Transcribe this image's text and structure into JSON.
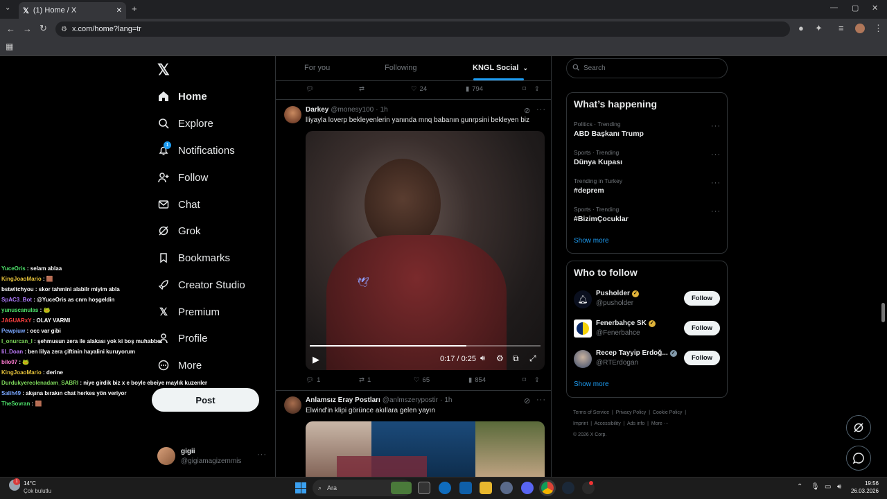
{
  "browser": {
    "tab_title": "(1) Home / X",
    "url": "x.com/home?lang=tr",
    "new_tab": "+",
    "controls": {
      "minimize": "—",
      "maximize": "▢",
      "close": "✕"
    }
  },
  "sidebar": {
    "items": [
      {
        "label": "Home",
        "icon": "home-icon"
      },
      {
        "label": "Explore",
        "icon": "search-icon"
      },
      {
        "label": "Notifications",
        "icon": "bell-icon",
        "badge": "1"
      },
      {
        "label": "Follow",
        "icon": "person-add-icon"
      },
      {
        "label": "Chat",
        "icon": "mail-icon"
      },
      {
        "label": "Grok",
        "icon": "grok-icon"
      },
      {
        "label": "Bookmarks",
        "icon": "bookmark-icon"
      },
      {
        "label": "Creator Studio",
        "icon": "rocket-icon"
      },
      {
        "label": "Premium",
        "icon": "x-icon"
      },
      {
        "label": "Profile",
        "icon": "person-icon"
      },
      {
        "label": "More",
        "icon": "more-circle-icon"
      }
    ],
    "post_label": "Post",
    "account": {
      "name": "gigii",
      "handle": "@gigiamagizemmis"
    }
  },
  "feed": {
    "tabs": [
      "For you",
      "Following",
      "KNGL Social"
    ],
    "prev_actions": {
      "replies": "",
      "reposts": "",
      "likes": "24",
      "views": "794"
    },
    "tweet1": {
      "name": "Darkey",
      "handle": "@monesy100",
      "time": "1h",
      "text": "lliyayla loverp bekleyenlerin yanında mnq babanın gunrpsini bekleyen biz",
      "video_time": "0:17 / 0:25",
      "video_progress": 0.68,
      "actions": {
        "replies": "1",
        "reposts": "1",
        "likes": "65",
        "views": "854"
      }
    },
    "tweet2": {
      "name": "Anlamsız Eray Postları",
      "handle": "@anlmszerypostir",
      "time": "1h",
      "text": "Elwind'in klipi görünce akıllara gelen yayın"
    }
  },
  "right": {
    "search_placeholder": "Search",
    "happening_title": "What’s happening",
    "trends": [
      {
        "category": "Politics · Trending",
        "name": "ABD Başkanı Trump"
      },
      {
        "category": "Sports · Trending",
        "name": "Dünya Kupası"
      },
      {
        "category": "Trending in Turkey",
        "name": "#deprem"
      },
      {
        "category": "Sports · Trending",
        "name": "#BizimÇocuklar"
      }
    ],
    "show_more": "Show more",
    "who_title": "Who to follow",
    "follow": [
      {
        "name": "Pusholder",
        "handle": "@pusholder",
        "badge_color": "#e0b33a"
      },
      {
        "name": "Fenerbahçe SK",
        "handle": "@Fenerbahce",
        "badge_color": "#e0b33a"
      },
      {
        "name": "Recep Tayyip Erdoğ...",
        "handle": "@RTErdogan",
        "badge_color": "#829aab"
      }
    ],
    "follow_label": "Follow",
    "footer": {
      "line1": [
        "Terms of Service",
        "Privacy Policy",
        "Cookie Policy"
      ],
      "line2": [
        "Imprint",
        "Accessibility",
        "Ads info",
        "More ···"
      ],
      "copyright": "© 2026 X Corp."
    }
  },
  "chat": [
    {
      "user": "YuceOris",
      "color": "#4ee26b",
      "msg": ": selam ablaa"
    },
    {
      "user": "KingJoaoMario",
      "color": "#e4c13a",
      "msg": ": 🟫"
    },
    {
      "user": "bstwitchyou",
      "color": "#ffffff",
      "msg": ": skor tahmini alabilr miyim abla"
    },
    {
      "user": "SpAC3_Bot",
      "color": "#b07cff",
      "msg": ": @YuceOris as cnm hoşgeldin"
    },
    {
      "user": "yunuscanulas",
      "color": "#4ee26b",
      "msg": ": 🐸"
    },
    {
      "user": "JAGUARxY",
      "color": "#ff4040",
      "msg": ": OLAY VARMI"
    },
    {
      "user": "Pewpiuw",
      "color": "#7aa7ff",
      "msg": ": occ var gibi"
    },
    {
      "user": "I_onurcan_I",
      "color": "#7cd65a",
      "msg": ": şehmusun zera ile alakası yok ki boş muhabbet"
    },
    {
      "user": "lil_Doan",
      "color": "#c27dff",
      "msg": ": ben lilya zera çiftinin hayalini kuruyorum"
    },
    {
      "user": "bilo07",
      "color": "#ff7ad1",
      "msg": ": 🐸"
    },
    {
      "user": "KingJoaoMario",
      "color": "#e4c13a",
      "msg": ": derine"
    },
    {
      "user": "Durdukyereolenadam_SABRI",
      "color": "#7cd65a",
      "msg": ": niye girdik biz x e boyle ebeiye maylık kuzenler"
    },
    {
      "user": "Salih49",
      "color": "#7aa7ff",
      "msg": ": akşına bırakın chat herkes yön veriyor"
    },
    {
      "user": "TheSovran",
      "color": "#4ee26b",
      "msg": ": 🟫"
    }
  ],
  "taskbar": {
    "weather_temp": "14°C",
    "weather_desc": "Çok bulutlu",
    "search_label": "Ara",
    "time": "19:56",
    "date": "26.03.2026"
  }
}
